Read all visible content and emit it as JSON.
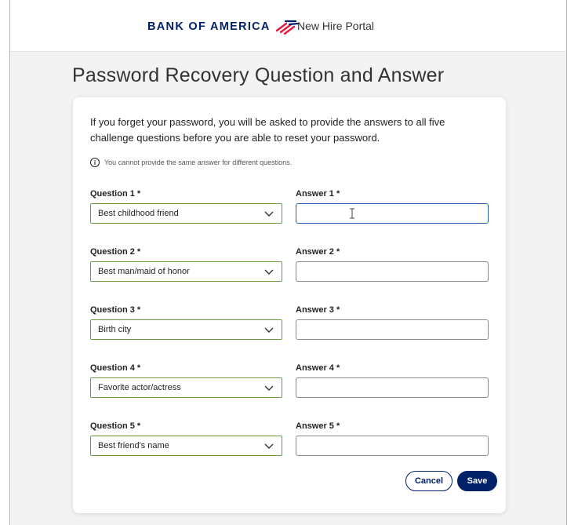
{
  "header": {
    "brand_name": "BANK OF AMERICA",
    "portal_name": "New Hire Portal",
    "brand_colors": {
      "navy": "#012169",
      "red": "#E31837"
    }
  },
  "page": {
    "title": "Password Recovery Question and Answer"
  },
  "form": {
    "intro": "If you forget your password, you will be asked to provide the answers to all five challenge questions before you are able to reset your password.",
    "note": "You cannot provide the same answer for different questions.",
    "note_icon": "info-icon",
    "rows": [
      {
        "question_label": "Question 1 *",
        "question_value": "Best childhood friend",
        "answer_label": "Answer 1 *",
        "answer_value": ""
      },
      {
        "question_label": "Question 2 *",
        "question_value": "Best man/maid of honor",
        "answer_label": "Answer 2 *",
        "answer_value": ""
      },
      {
        "question_label": "Question 3 *",
        "question_value": "Birth city",
        "answer_label": "Answer 3 *",
        "answer_value": ""
      },
      {
        "question_label": "Question 4 *",
        "question_value": "Favorite actor/actress",
        "answer_label": "Answer 4 *",
        "answer_value": ""
      },
      {
        "question_label": "Question 5 *",
        "question_value": "Best friend's name",
        "answer_label": "Answer 5 *",
        "answer_value": ""
      }
    ],
    "cancel_label": "Cancel",
    "save_label": "Save"
  }
}
